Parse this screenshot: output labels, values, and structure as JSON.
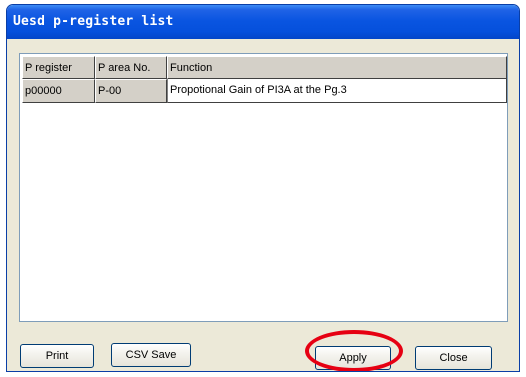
{
  "window": {
    "title": "Uesd p-register list"
  },
  "table": {
    "columns": [
      "P register",
      "P area No.",
      "Function"
    ],
    "rows": [
      {
        "p_register": "p00000",
        "p_area_no": "P-00",
        "function": "Propotional Gain of PI3A at the Pg.3"
      }
    ]
  },
  "buttons": {
    "print": "Print",
    "csv_save": "CSV Save",
    "apply": "Apply",
    "close": "Close"
  },
  "annotation": {
    "highlight_target": "apply-button",
    "highlight_color": "#e60012"
  },
  "colors": {
    "titlebar": "#0a55e1",
    "window_bg": "#ece9d8",
    "header_cell_bg": "#d4d0c8"
  }
}
